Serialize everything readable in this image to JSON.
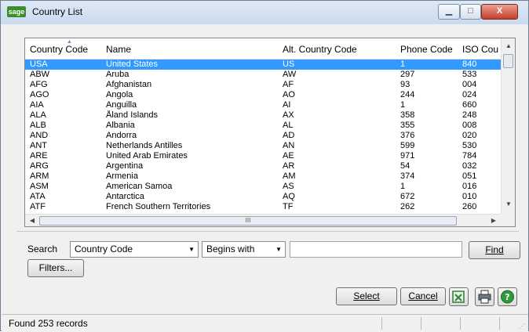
{
  "window": {
    "title": "Country List",
    "logo_text": "sage",
    "minimize_glyph": "▁",
    "maximize_glyph": "□",
    "close_glyph": "X"
  },
  "grid": {
    "columns": [
      "Country Code",
      "Name",
      "Alt. Country Code",
      "Phone Code",
      "ISO Cou"
    ],
    "rows": [
      [
        "USA",
        "United States",
        "US",
        "1",
        "840"
      ],
      [
        "ABW",
        "Aruba",
        "AW",
        "297",
        "533"
      ],
      [
        "AFG",
        "Afghanistan",
        "AF",
        "93",
        "004"
      ],
      [
        "AGO",
        "Angola",
        "AO",
        "244",
        "024"
      ],
      [
        "AIA",
        "Anguilla",
        "AI",
        "1",
        "660"
      ],
      [
        "ALA",
        "Åland Islands",
        "AX",
        "358",
        "248"
      ],
      [
        "ALB",
        "Albania",
        "AL",
        "355",
        "008"
      ],
      [
        "AND",
        "Andorra",
        "AD",
        "376",
        "020"
      ],
      [
        "ANT",
        "Netherlands Antilles",
        "AN",
        "599",
        "530"
      ],
      [
        "ARE",
        "United Arab Emirates",
        "AE",
        "971",
        "784"
      ],
      [
        "ARG",
        "Argentina",
        "AR",
        "54",
        "032"
      ],
      [
        "ARM",
        "Armenia",
        "AM",
        "374",
        "051"
      ],
      [
        "ASM",
        "American Samoa",
        "AS",
        "1",
        "016"
      ],
      [
        "ATA",
        "Antarctica",
        "AQ",
        "672",
        "010"
      ],
      [
        "ATF",
        "French Southern Territories",
        "TF",
        "262",
        "260"
      ]
    ],
    "selected_row": 0,
    "hscroll_thumb_glyph": "III"
  },
  "search": {
    "label": "Search",
    "field_value": "Country Code",
    "operator_value": "Begins with",
    "text_value": "",
    "find_label": "Find",
    "filters_label": "Filters..."
  },
  "buttons": {
    "select_label": "Select",
    "cancel_label": "Cancel"
  },
  "icons": {
    "export": "excel-export-icon",
    "print": "printer-icon",
    "help": "help-icon"
  },
  "status": {
    "text": "Found 253 records"
  },
  "colors": {
    "selection": "#3399ff",
    "help_green": "#2f9a3a"
  }
}
